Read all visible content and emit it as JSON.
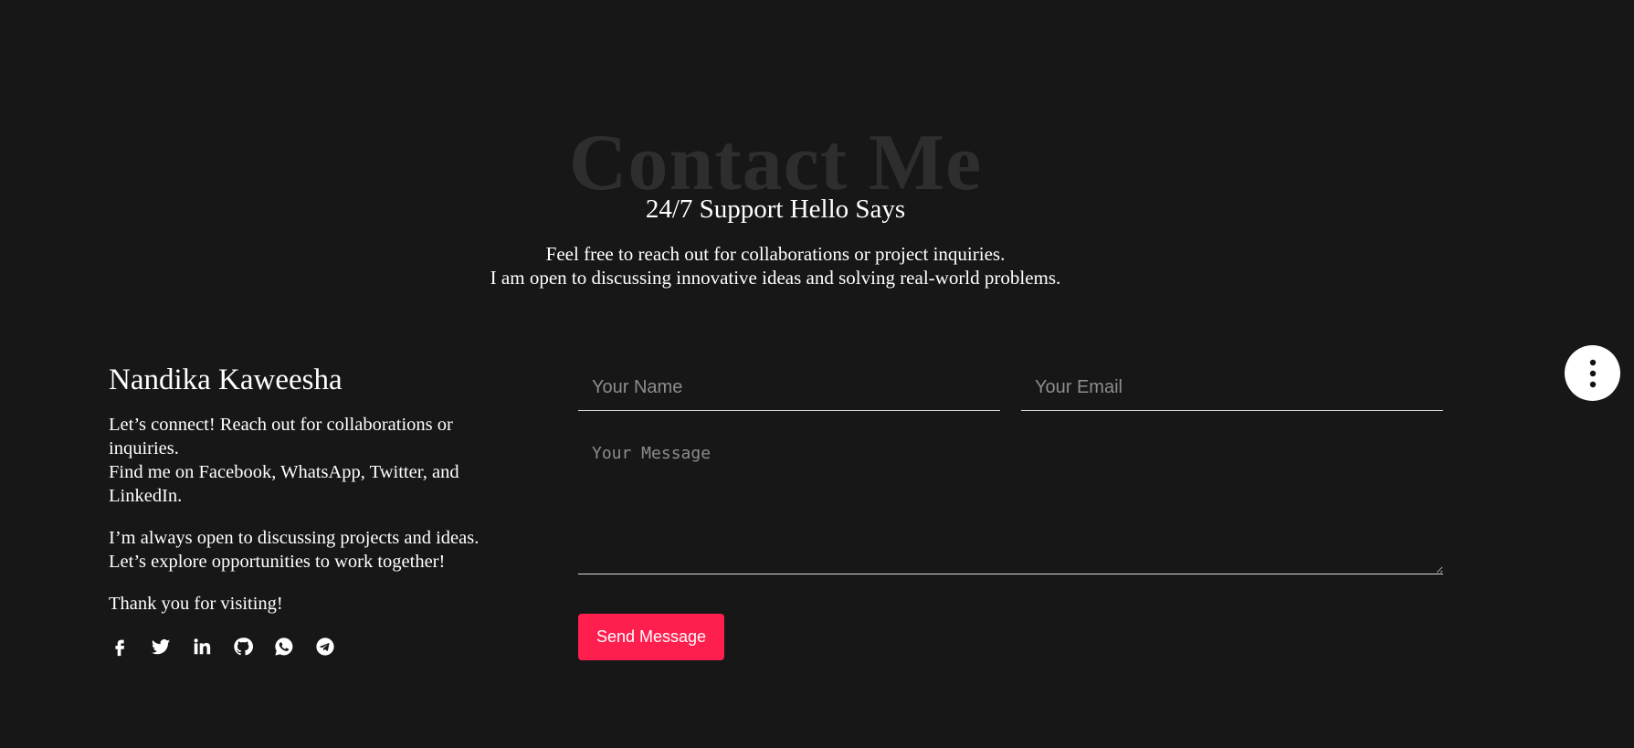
{
  "header": {
    "background_title": "Contact Me",
    "subtitle": "24/7 Support Hello Says",
    "intro_lines": [
      "Feel free to reach out for collaborations or project inquiries.",
      "I am open to discussing innovative ideas and solving real-world problems."
    ]
  },
  "profile": {
    "name": "Nandika Kaweesha",
    "paragraph1": [
      "Let’s connect! Reach out for collaborations or inquiries.",
      "Find me on Facebook, WhatsApp, Twitter, and LinkedIn."
    ],
    "paragraph2": [
      "I’m always open to discussing projects and ideas.",
      "Let’s explore opportunities to work together!"
    ],
    "thanks": "Thank you for visiting!",
    "socials": [
      "facebook-icon",
      "twitter-icon",
      "linkedin-icon",
      "github-icon",
      "whatsapp-icon",
      "telegram-icon"
    ]
  },
  "form": {
    "name_placeholder": "Your Name",
    "name_value": "",
    "email_placeholder": "Your Email",
    "email_value": "",
    "message_placeholder": "Your Message",
    "message_value": "",
    "submit_label": "Send Message"
  },
  "colors": {
    "background": "#171717",
    "accent": "#ff1f4f",
    "title_shadow": "#2e2e2e",
    "placeholder": "#8d8d8d"
  },
  "fab": {
    "icon": "more-vertical-icon"
  }
}
